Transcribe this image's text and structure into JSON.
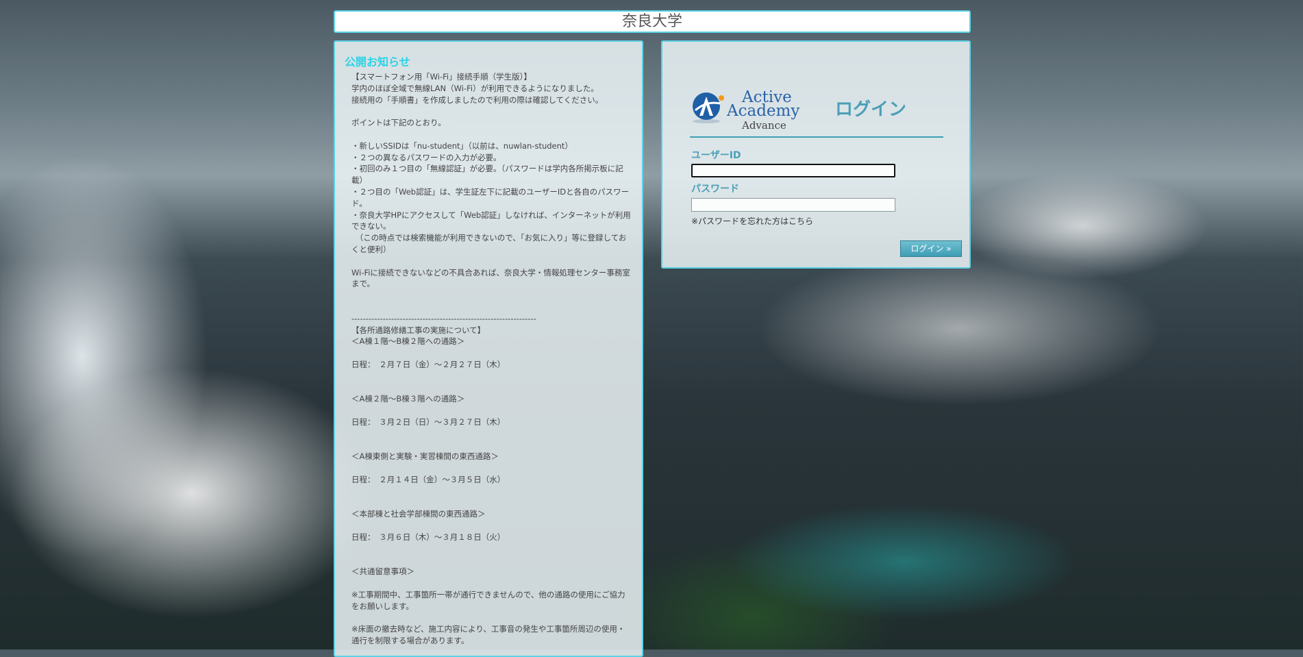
{
  "header": {
    "university_name": "奈良大学"
  },
  "notice": {
    "heading": "公開お知らせ",
    "body": "【スマートフォン用「Wi-Fi」接続手順（学生版）】\n学内のほぼ全域で無線LAN（Wi-Fi）が利用できるようになりました。\n接続用の「手順書」を作成しましたので利用の際は確認してください。\n\nポイントは下記のとおり。\n\n・新しいSSIDは「nu-student」（以前は、nuwlan-student）\n・２つの異なるパスワードの入力が必要。\n・初回のみ１つ目の「無線認証」が必要。（パスワードは学内各所掲示板に記載）\n・２つ目の「Web認証」は、学生証左下に記載のユーザーIDと各自のパスワード。\n・奈良大学HPにアクセスして「Web認証」しなければ、インターネットが利用できない。\n　（この時点では検索機能が利用できないので、「お気に入り」等に登録しておくと便利）\n\nWi-Fiに接続できないなどの不具合あれば、奈良大学・情報処理センター事務室まで。\n\n\n-----------------------------------------------------------------\n【各所通路修繕工事の実施について】\n＜A棟１階～B棟２階への通路＞\n\n日程：　２月７日（金）～２月２７日（木）\n\n\n＜A棟２階～B棟３階への通路＞\n\n日程：　３月２日（日）～３月２７日（木）\n\n\n＜A棟東側と実験・実習棟間の東西通路＞\n\n日程：　２月１４日（金）～３月５日（水）\n\n\n＜本部棟と社会学部棟間の東西通路＞\n\n日程：　３月６日（木）～３月１８日（火）\n\n\n＜共通留意事項＞\n\n※工事期間中、工事箇所一帯が通行できませんので、他の通路の使用にご協力をお願いします。\n\n※床面の撤去時など、施工内容により、工事音の発生や工事箇所周辺の使用・通行を制限する場合があります。"
  },
  "login": {
    "logo": {
      "line1": "Active",
      "line2": "Academy",
      "line3": "Advance",
      "icon": "active-academy-logo-mark"
    },
    "title": "ログイン",
    "user_id_label": "ユーザーID",
    "user_id_value": "",
    "password_label": "パスワード",
    "password_value": "",
    "forgot_password": "※パスワードを忘れた方はこちら",
    "submit_label": "ログイン »"
  },
  "colors": {
    "panel_border": "#5cd2e6",
    "heading_cyan": "#2bd3e4",
    "accent_teal": "#4a9fb6",
    "button": "#3f9db4"
  }
}
